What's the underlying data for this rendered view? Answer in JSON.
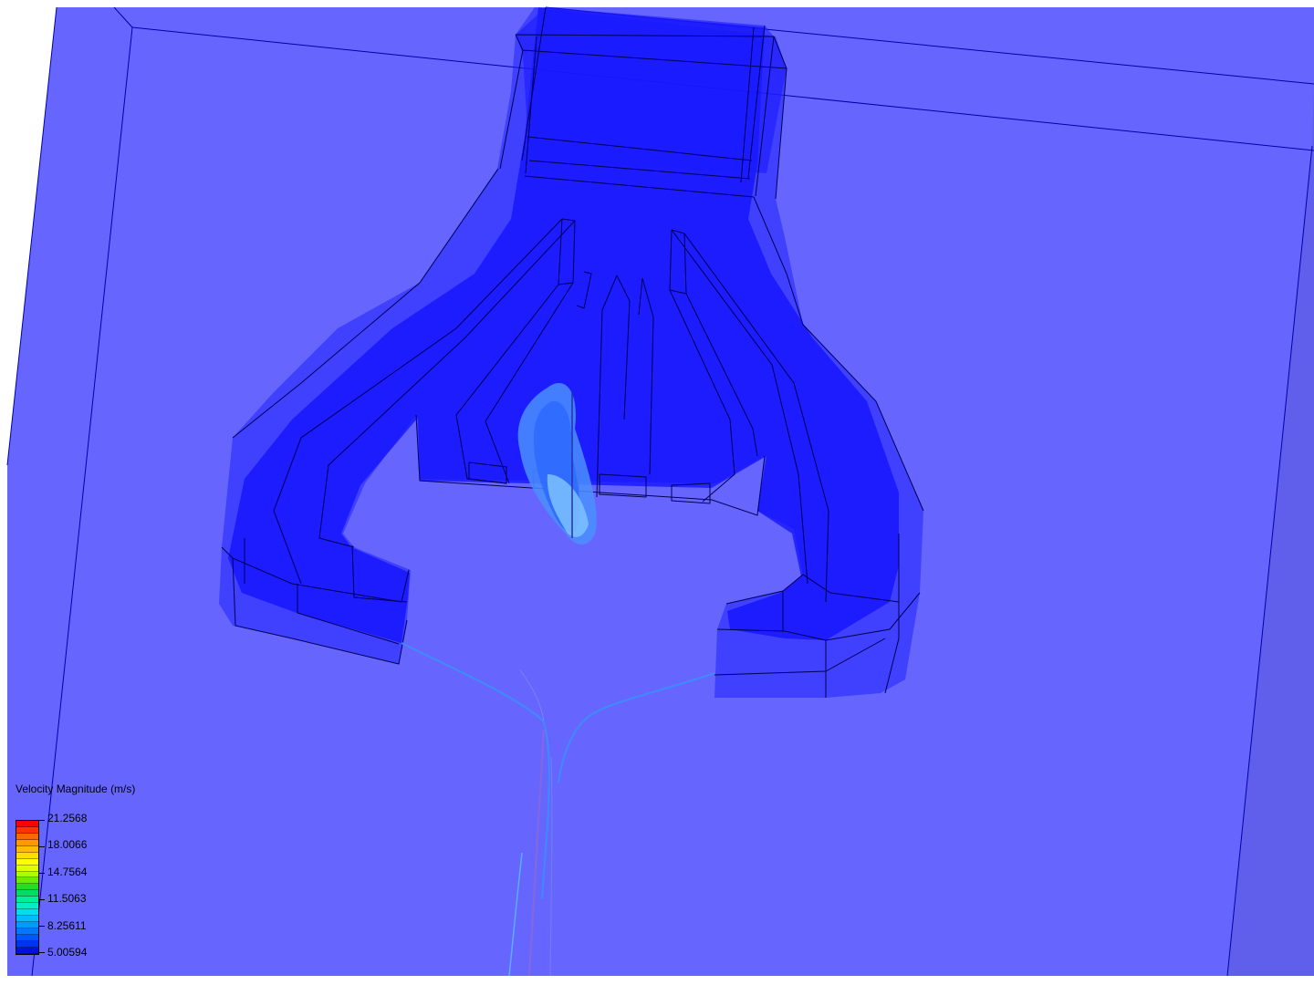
{
  "app": {
    "view": "3D CFD result viewport"
  },
  "scene": {
    "background_color": "#ffffff",
    "domain_color": "#6666ff",
    "domain_side_color": "#5f5fec",
    "body_color": "#1a1aff",
    "body_light_color": "#3333ff",
    "edge_color": "#000066",
    "jet_colors": [
      "#7ab6ff",
      "#3f8bff",
      "#2a6bff"
    ],
    "streak_colors": [
      "#4aa6ff",
      "#7755cc"
    ]
  },
  "legend": {
    "title": "Velocity Magnitude (m/s)",
    "ticks": [
      "21.2568",
      "18.0066",
      "14.7564",
      "11.5063",
      "8.25611",
      "5.00594"
    ],
    "colormap": [
      "#ff0000",
      "#ff3300",
      "#ff6600",
      "#ff9900",
      "#ffbb00",
      "#ffdd00",
      "#ffff00",
      "#ddff00",
      "#aaff00",
      "#66ee00",
      "#22dd22",
      "#00dd66",
      "#00ee99",
      "#00eecc",
      "#00ddee",
      "#00bbff",
      "#0099ff",
      "#0077ff",
      "#0055ff",
      "#0033ee",
      "#0011dd"
    ]
  }
}
